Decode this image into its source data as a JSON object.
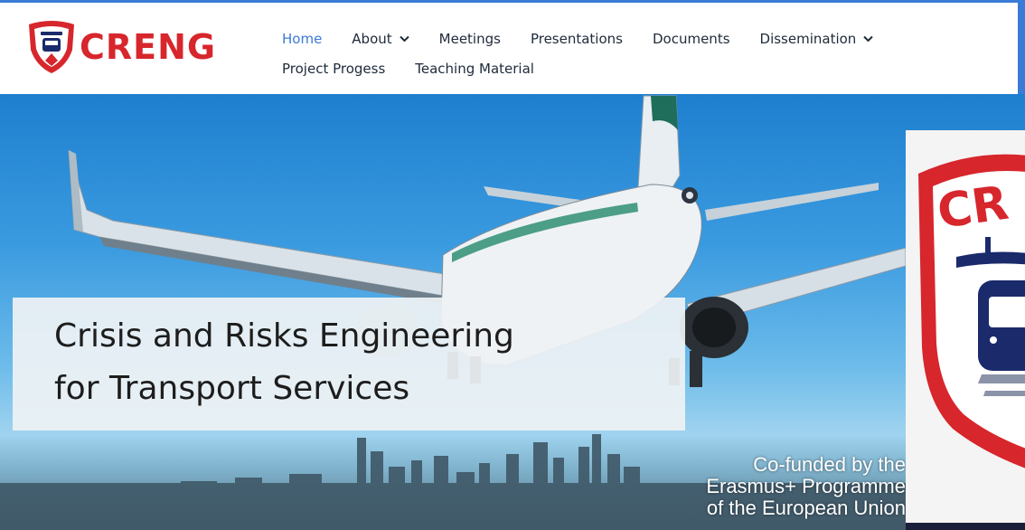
{
  "brand": {
    "name": "CRENG",
    "colors": {
      "red": "#d7262c",
      "navy": "#1b2a6b",
      "accent": "#3b7bd6"
    }
  },
  "nav": {
    "items": [
      {
        "label": "Home",
        "active": true
      },
      {
        "label": "About",
        "dropdown": true
      },
      {
        "label": "Meetings"
      },
      {
        "label": "Presentations"
      },
      {
        "label": "Documents"
      },
      {
        "label": "Dissemination",
        "dropdown": true
      },
      {
        "label": "Project Progess"
      },
      {
        "label": "Teaching Material"
      }
    ]
  },
  "hero": {
    "title_line1": "Crisis and Risks Engineering",
    "title_line2": "for Transport Services",
    "cofunded": {
      "line1": "Co-funded by the",
      "line2": "Erasmus+ Programme",
      "line3": "of the European Union"
    }
  },
  "popup": {
    "logo_text": "CR",
    "icon": "creng-logo-zoom"
  }
}
